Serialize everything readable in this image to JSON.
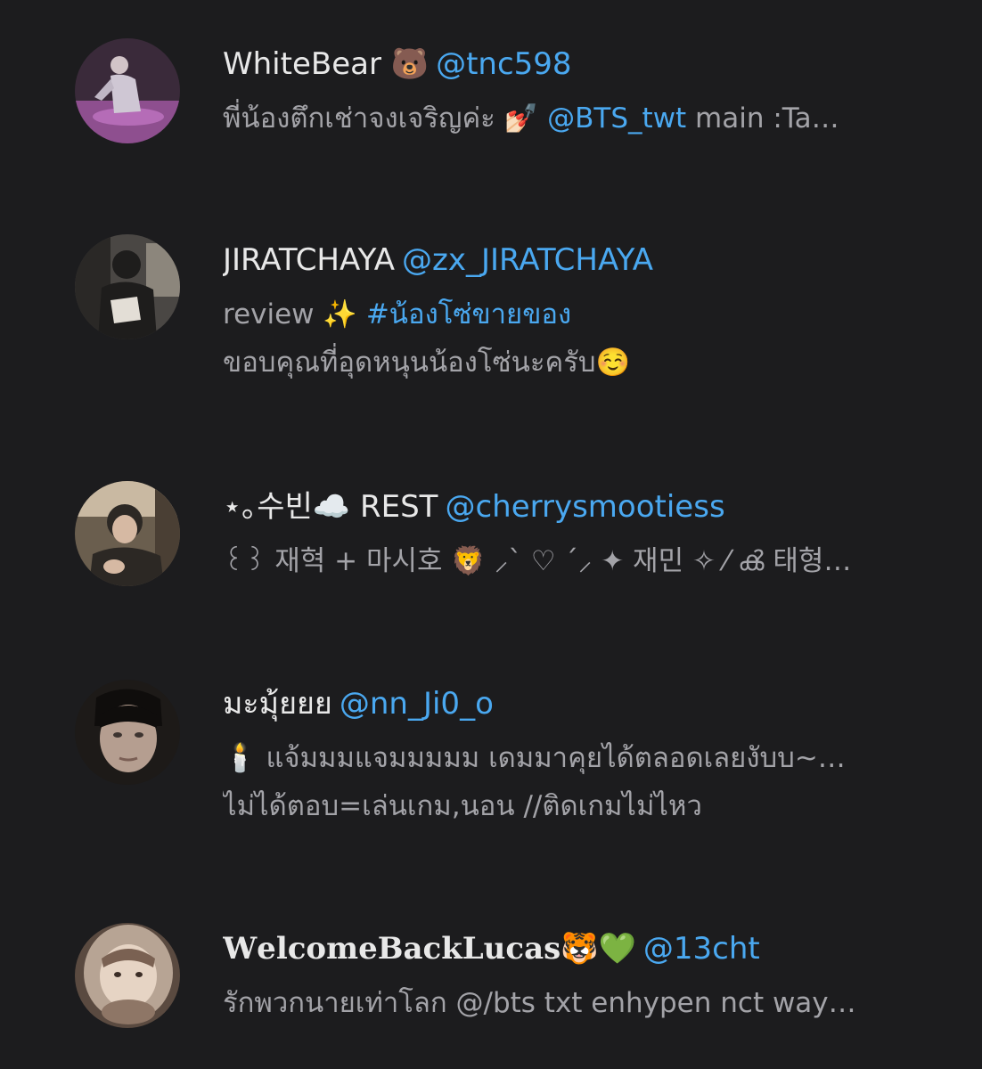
{
  "accounts": [
    {
      "display_name": "WhiteBear 🐻",
      "handle": "@tnc598",
      "bio": [
        [
          {
            "t": "พี่น้องตึกเช่าจงเจริญค่ะ 💅🏻 "
          },
          {
            "t": "@BTS_twt",
            "link": true
          },
          {
            "t": " main :Ta…"
          }
        ]
      ],
      "avatar_colors": [
        "#3a2a3a",
        "#8e4f8f",
        "#cfc7d4"
      ]
    },
    {
      "display_name": "JIRATCHAYA",
      "handle": "@zx_JIRATCHAYA",
      "bio": [
        [
          {
            "t": "review ✨ "
          },
          {
            "t": "#น้องโซ่ขายของ",
            "link": true,
            "partial": "#น้"
          }
        ],
        [
          {
            "t": "ขอบคุณที่อุดหนุนน้องโซ่นะครับ☺️"
          }
        ]
      ],
      "avatar_colors": [
        "#4a4744",
        "#1e1d1c",
        "#8c867c"
      ]
    },
    {
      "display_name": "⋆｡수빈☁️ REST",
      "handle": "@cherrysmootiess",
      "bio": [
        [
          {
            "t": "꒰꒱ 재혁 + 마시호 🦁 ⸝ˋ ♡ ˊ⸝ ✦ 재민 ✧ ⁄ ൿ 태형…"
          }
        ]
      ],
      "avatar_colors": [
        "#6a5e4e",
        "#2c2824",
        "#c9b9a2"
      ]
    },
    {
      "display_name": "มะมุ้ยยย",
      "handle": "@nn_Ji0_o",
      "bio": [
        [
          {
            "t": "🕯️ แจ้มมมแจมมมมม เดมมาคุยได้ตลอดเลยงับบ~…"
          }
        ],
        [
          {
            "t": "ไม่ได้ตอบ=เล่นเกม,นอน //ติดเกมไม่ไหว"
          }
        ]
      ],
      "avatar_colors": [
        "#1d1a18",
        "#b59e90",
        "#3d3430"
      ]
    },
    {
      "display_name": "𝐖𝐞𝐥𝐜𝐨𝐦𝐞𝐁𝐚𝐜𝐤𝐋𝐮𝐜𝐚𝐬🐯💚",
      "handle": "@13cht",
      "bio": [
        [
          {
            "t": "รักพวกนายเท่าโลก @/bts txt enhypen nct way…"
          }
        ]
      ],
      "avatar_colors": [
        "#b7a494",
        "#5a4a40",
        "#e6d4c4"
      ]
    }
  ]
}
